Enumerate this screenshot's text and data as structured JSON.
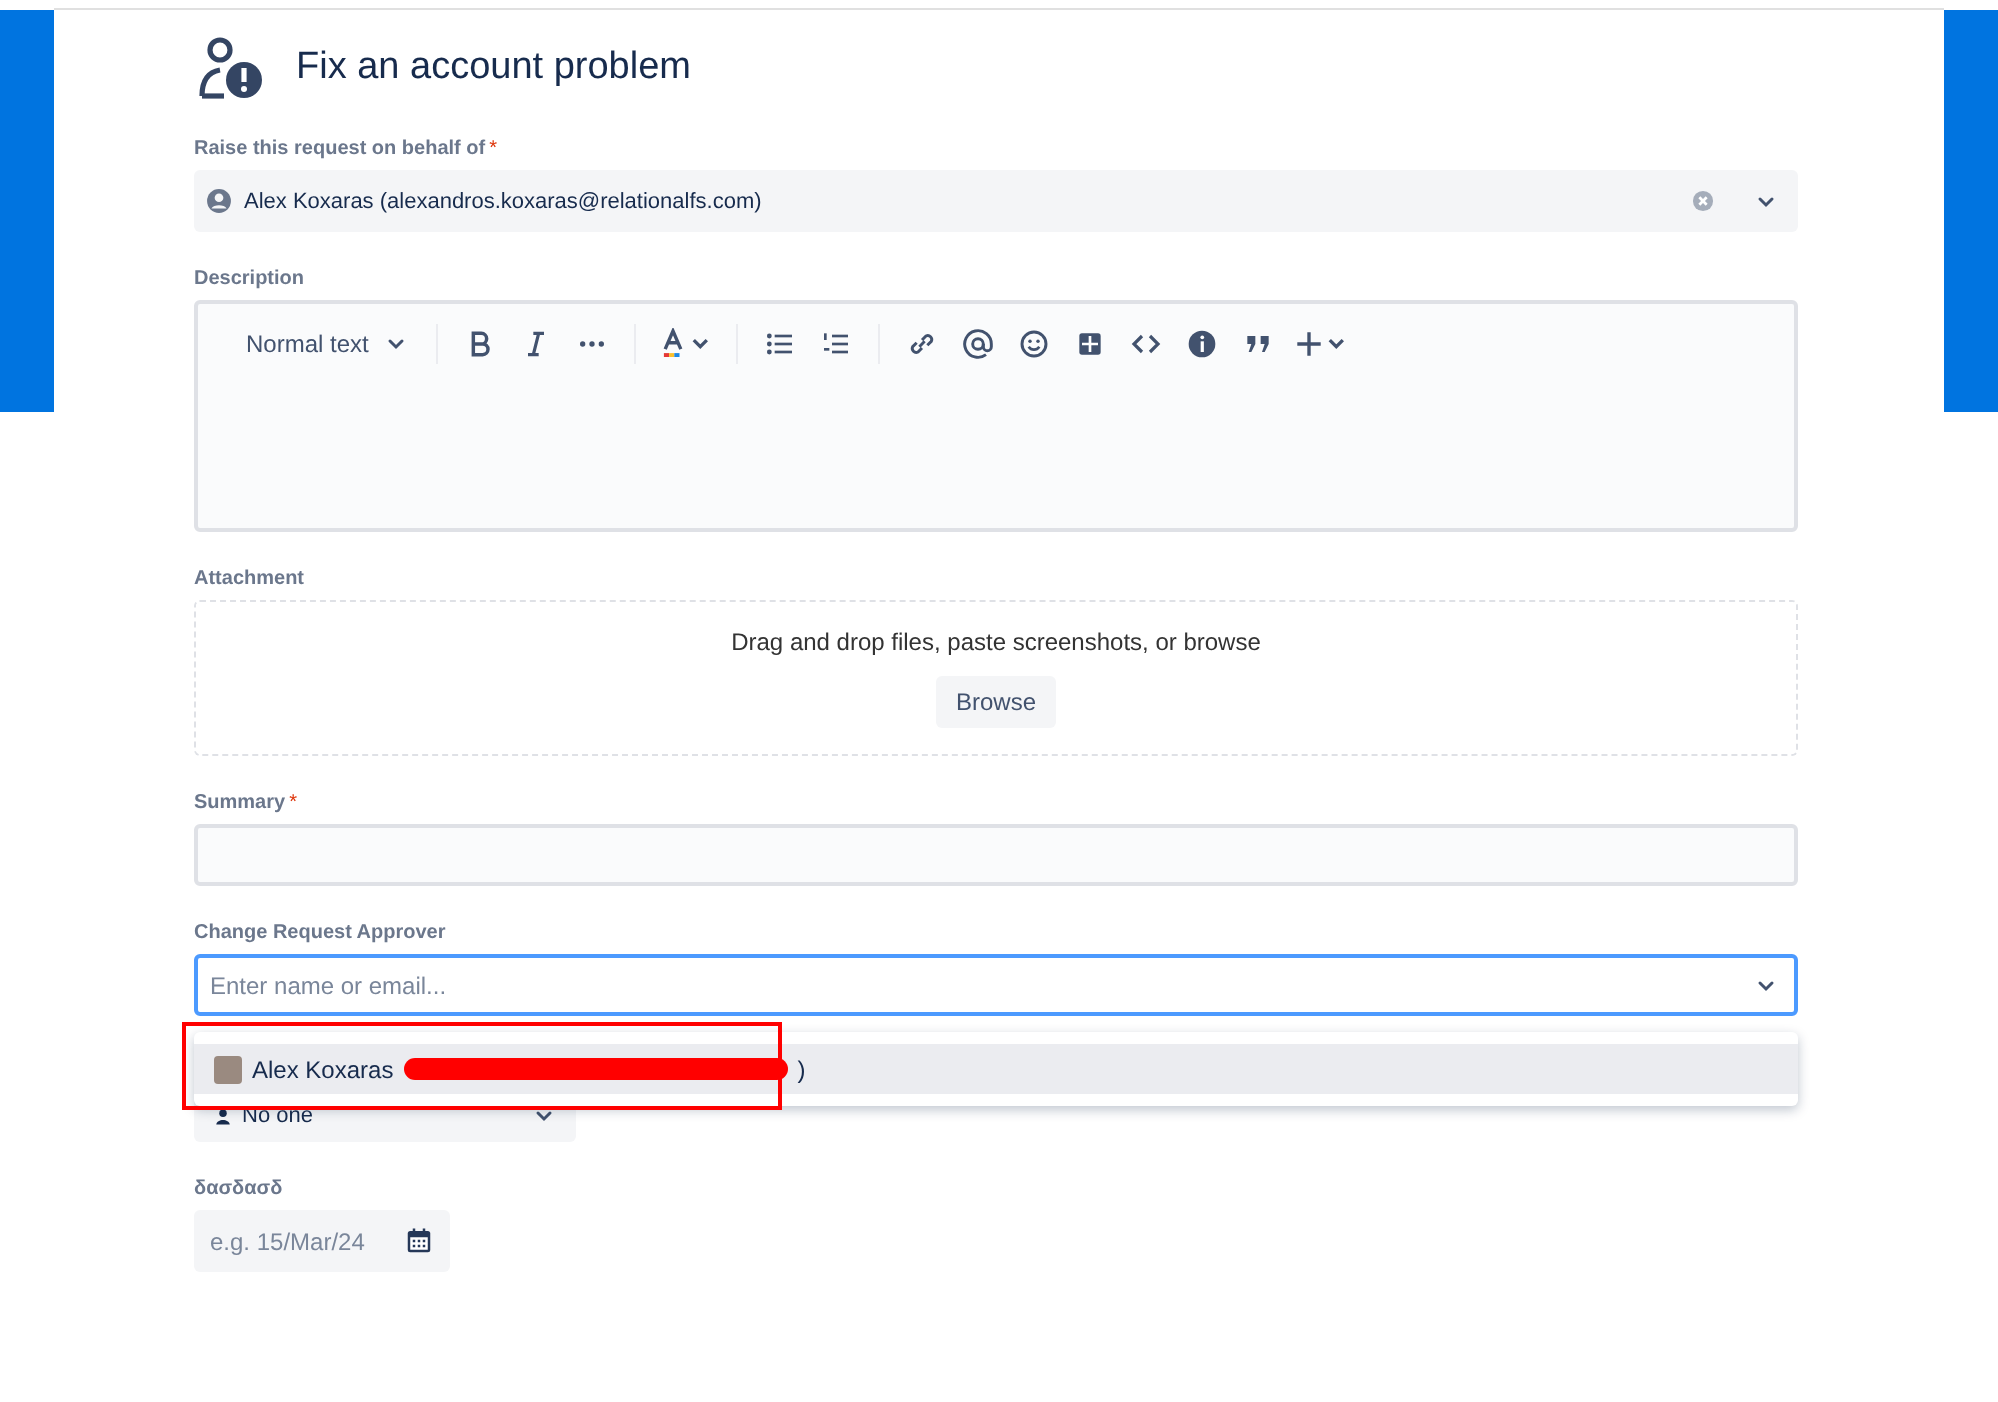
{
  "header": {
    "title": "Fix an account problem"
  },
  "fields": [
    {
      "kind": "user_select",
      "label": "Raise this request on behalf of",
      "required_mark": "*",
      "value": "Alex Koxaras (alexandros.koxaras@relationalfs.com)"
    },
    {
      "kind": "editor",
      "label": "Description",
      "text_style": "Normal text"
    },
    {
      "kind": "attachment",
      "label": "Attachment",
      "hint": "Drag and drop files, paste screenshots, or browse",
      "button": "Browse"
    },
    {
      "kind": "text",
      "label": "Summary",
      "required_mark": "*"
    },
    {
      "kind": "user_picker",
      "label": "Change Request Approver",
      "placeholder": "Enter name or email...",
      "focused": true,
      "options": [
        {
          "name": "Alex Koxaras",
          "tail": ")",
          "redacted": true,
          "selected": true
        }
      ],
      "covered_select": "No one"
    },
    {
      "kind": "date",
      "label": "δασδασδ",
      "placeholder": "e.g. 15/Mar/24"
    }
  ]
}
